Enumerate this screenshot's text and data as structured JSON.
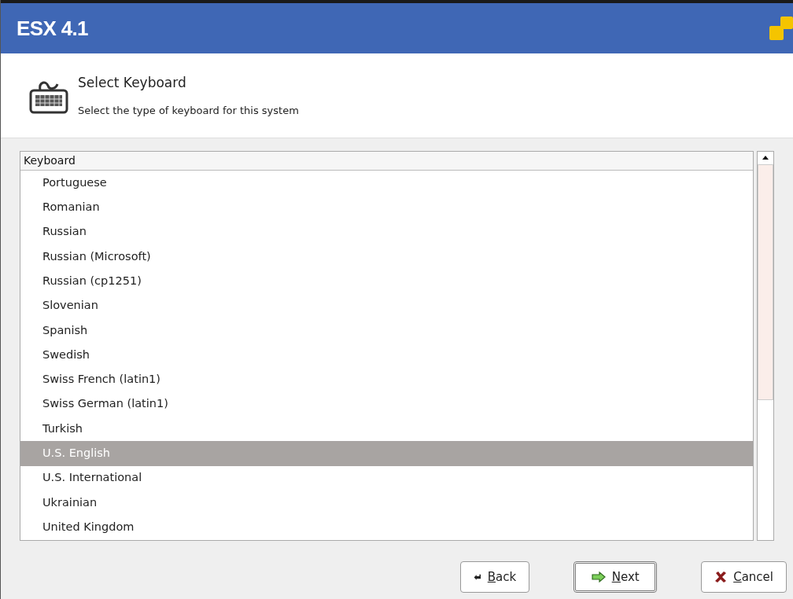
{
  "banner": {
    "title": "ESX 4.1"
  },
  "header": {
    "title": "Select Keyboard",
    "subtitle": "Select the type of keyboard for this system"
  },
  "list": {
    "column": "Keyboard",
    "items": [
      {
        "label": "Portuguese",
        "selected": false
      },
      {
        "label": "Romanian",
        "selected": false
      },
      {
        "label": "Russian",
        "selected": false
      },
      {
        "label": "Russian (Microsoft)",
        "selected": false
      },
      {
        "label": "Russian (cp1251)",
        "selected": false
      },
      {
        "label": "Slovenian",
        "selected": false
      },
      {
        "label": "Spanish",
        "selected": false
      },
      {
        "label": "Swedish",
        "selected": false
      },
      {
        "label": "Swiss French (latin1)",
        "selected": false
      },
      {
        "label": "Swiss German (latin1)",
        "selected": false
      },
      {
        "label": "Turkish",
        "selected": false
      },
      {
        "label": "U.S. English",
        "selected": true
      },
      {
        "label": "U.S. International",
        "selected": false
      },
      {
        "label": "Ukrainian",
        "selected": false
      },
      {
        "label": "United Kingdom",
        "selected": false
      }
    ]
  },
  "buttons": [
    {
      "kind": "back",
      "mnemonic": "B",
      "rest": "ack",
      "default": false
    },
    {
      "kind": "next",
      "mnemonic": "N",
      "rest": "ext",
      "default": true
    },
    {
      "kind": "cancel",
      "mnemonic": "C",
      "rest": "ancel",
      "default": false
    }
  ]
}
